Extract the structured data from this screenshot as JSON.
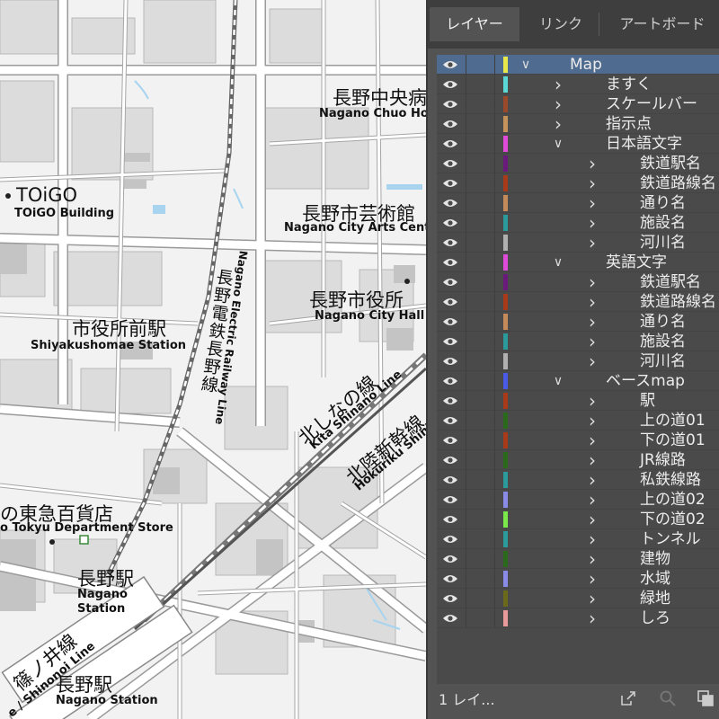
{
  "map": {
    "labels": {
      "toigo_jp": "TOiGO",
      "toigo_en": "TOiGO Building",
      "chuo_jp": "長野中央病",
      "chuo_en": "Nagano Chuo Hos",
      "arts_jp": "長野市芸術館",
      "arts_en": "Nagano City Arts Cente",
      "cityhall_jp": "長野市役所",
      "cityhall_en": "Nagano City Hall",
      "shiyaku_jp": "市役所前駅",
      "shiyaku_en": "Shiyakushomae Station",
      "electric_jp": "長野電鉄長野線",
      "electric_en": "Nagano Electric Railway Line",
      "kitashinano_jp": "北しなの線",
      "kitashinano_en": "Kita Shinano Line",
      "hokuriku_jp": "北陸新幹線",
      "hokuriku_en": "Hokuriku Shink",
      "tokyu_jp": "の東急百貨店",
      "tokyu_en": "o Tokyu Department Store",
      "nagano1_jp": "長野駅",
      "nagano1_en1": "Nagano",
      "nagano1_en2": "Station",
      "shinonoi_jp": "篠ノ井線",
      "shinonoi_en": "e / Shinonoi Line",
      "nagano2_jp": "長野駅",
      "nagano2_en": "Nagano Station"
    }
  },
  "panel": {
    "tabs": [
      {
        "label": "レイヤー",
        "active": true
      },
      {
        "label": "リンク",
        "active": false
      },
      {
        "label": "アートボード",
        "active": false
      }
    ],
    "layers": [
      {
        "name": "Map",
        "depth": 0,
        "expanded": true,
        "color": "#e8e84a",
        "selected": true
      },
      {
        "name": "ますく",
        "depth": 1,
        "expanded": false,
        "color": "#5ad8d8"
      },
      {
        "name": "スケールバー",
        "depth": 1,
        "expanded": false,
        "color": "#9a4a2a"
      },
      {
        "name": "指示点",
        "depth": 1,
        "expanded": false,
        "color": "#c4925a"
      },
      {
        "name": "日本語文字",
        "depth": 1,
        "expanded": true,
        "color": "#e04ad8"
      },
      {
        "name": "鉄道駅名",
        "depth": 2,
        "expanded": false,
        "color": "#6a1a7a"
      },
      {
        "name": "鉄道路線名",
        "depth": 2,
        "expanded": false,
        "color": "#a83a1a"
      },
      {
        "name": "通り名",
        "depth": 2,
        "expanded": false,
        "color": "#c48a5a"
      },
      {
        "name": "施設名",
        "depth": 2,
        "expanded": false,
        "color": "#2a9a9a"
      },
      {
        "name": "河川名",
        "depth": 2,
        "expanded": false,
        "color": "#b0b0b0"
      },
      {
        "name": "英語文字",
        "depth": 1,
        "expanded": true,
        "color": "#e04ad8"
      },
      {
        "name": "鉄道駅名",
        "depth": 2,
        "expanded": false,
        "color": "#6a1a7a"
      },
      {
        "name": "鉄道路線名",
        "depth": 2,
        "expanded": false,
        "color": "#a83a1a"
      },
      {
        "name": "通り名",
        "depth": 2,
        "expanded": false,
        "color": "#c48a5a"
      },
      {
        "name": "施設名",
        "depth": 2,
        "expanded": false,
        "color": "#2a9a9a"
      },
      {
        "name": "河川名",
        "depth": 2,
        "expanded": false,
        "color": "#b0b0b0"
      },
      {
        "name": "ベースmap",
        "depth": 1,
        "expanded": true,
        "color": "#4a5ae8"
      },
      {
        "name": "駅",
        "depth": 2,
        "expanded": false,
        "color": "#a83a1a"
      },
      {
        "name": "上の道01",
        "depth": 2,
        "expanded": false,
        "color": "#2a6a1a"
      },
      {
        "name": "下の道01",
        "depth": 2,
        "expanded": false,
        "color": "#a83a1a"
      },
      {
        "name": "JR線路",
        "depth": 2,
        "expanded": false,
        "color": "#2a6a1a"
      },
      {
        "name": "私鉄線路",
        "depth": 2,
        "expanded": false,
        "color": "#2a9a9a"
      },
      {
        "name": "上の道02",
        "depth": 2,
        "expanded": false,
        "color": "#8a8ae8"
      },
      {
        "name": "下の道02",
        "depth": 2,
        "expanded": false,
        "color": "#7ae84a"
      },
      {
        "name": "トンネル",
        "depth": 2,
        "expanded": false,
        "color": "#2a9a9a"
      },
      {
        "name": "建物",
        "depth": 2,
        "expanded": false,
        "color": "#2a6a1a"
      },
      {
        "name": "水域",
        "depth": 2,
        "expanded": false,
        "color": "#8a8ae8"
      },
      {
        "name": "緑地",
        "depth": 2,
        "expanded": false,
        "color": "#6a6a1a"
      },
      {
        "name": "しろ",
        "depth": 2,
        "expanded": false,
        "color": "#e89a9a"
      }
    ],
    "footer": {
      "count": "1 レイ..."
    }
  }
}
